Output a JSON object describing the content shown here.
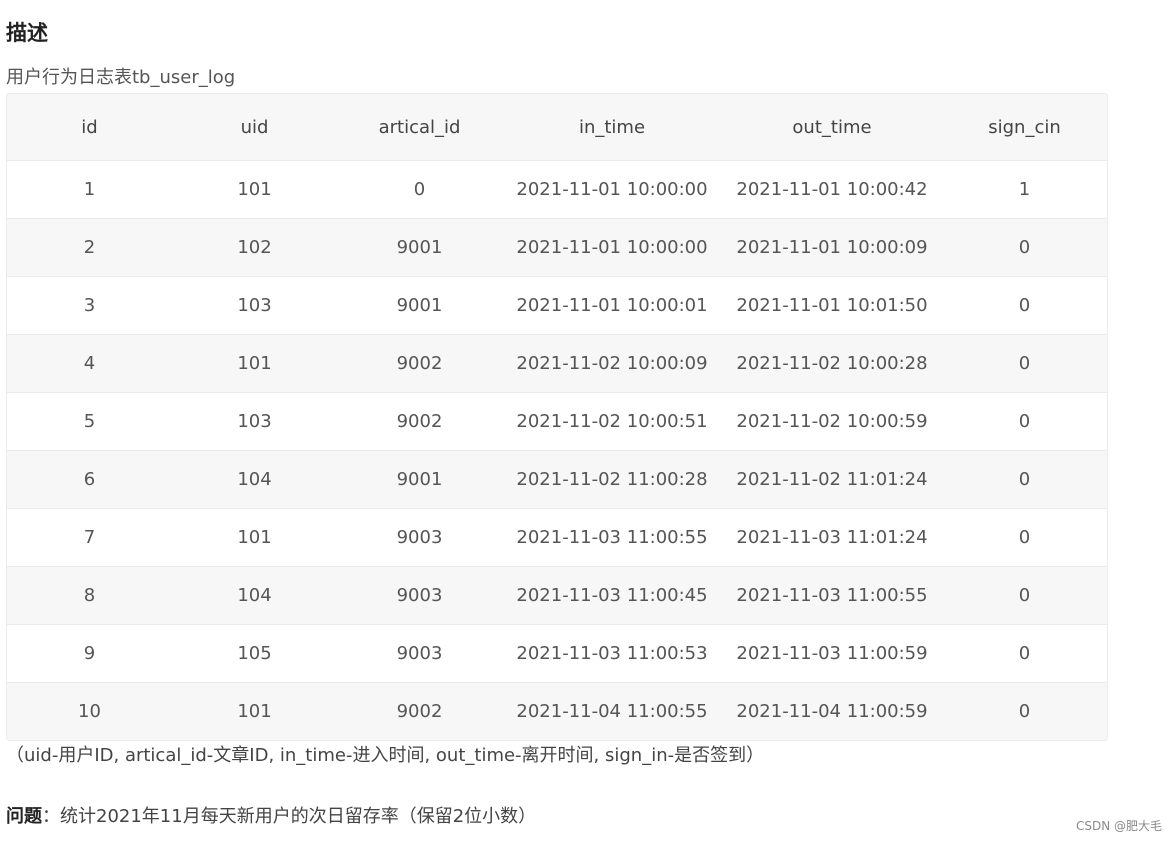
{
  "heading": "描述",
  "subtitle": "用户行为日志表tb_user_log",
  "table": {
    "columns": [
      "id",
      "uid",
      "artical_id",
      "in_time",
      "out_time",
      "sign_cin"
    ],
    "rows": [
      [
        "1",
        "101",
        "0",
        "2021-11-01 10:00:00",
        "2021-11-01 10:00:42",
        "1"
      ],
      [
        "2",
        "102",
        "9001",
        "2021-11-01 10:00:00",
        "2021-11-01 10:00:09",
        "0"
      ],
      [
        "3",
        "103",
        "9001",
        "2021-11-01 10:00:01",
        "2021-11-01 10:01:50",
        "0"
      ],
      [
        "4",
        "101",
        "9002",
        "2021-11-02 10:00:09",
        "2021-11-02 10:00:28",
        "0"
      ],
      [
        "5",
        "103",
        "9002",
        "2021-11-02 10:00:51",
        "2021-11-02 10:00:59",
        "0"
      ],
      [
        "6",
        "104",
        "9001",
        "2021-11-02 11:00:28",
        "2021-11-02 11:01:24",
        "0"
      ],
      [
        "7",
        "101",
        "9003",
        "2021-11-03 11:00:55",
        "2021-11-03 11:01:24",
        "0"
      ],
      [
        "8",
        "104",
        "9003",
        "2021-11-03 11:00:45",
        "2021-11-03 11:00:55",
        "0"
      ],
      [
        "9",
        "105",
        "9003",
        "2021-11-03 11:00:53",
        "2021-11-03 11:00:59",
        "0"
      ],
      [
        "10",
        "101",
        "9002",
        "2021-11-04 11:00:55",
        "2021-11-04 11:00:59",
        "0"
      ]
    ]
  },
  "note": "（uid-用户ID, artical_id-文章ID, in_time-进入时间, out_time-离开时间, sign_in-是否签到）",
  "question": {
    "label": "问题",
    "separator": "：",
    "text": "统计2021年11月每天新用户的次日留存率（保留2位小数）"
  },
  "watermark": "CSDN @肥大毛"
}
